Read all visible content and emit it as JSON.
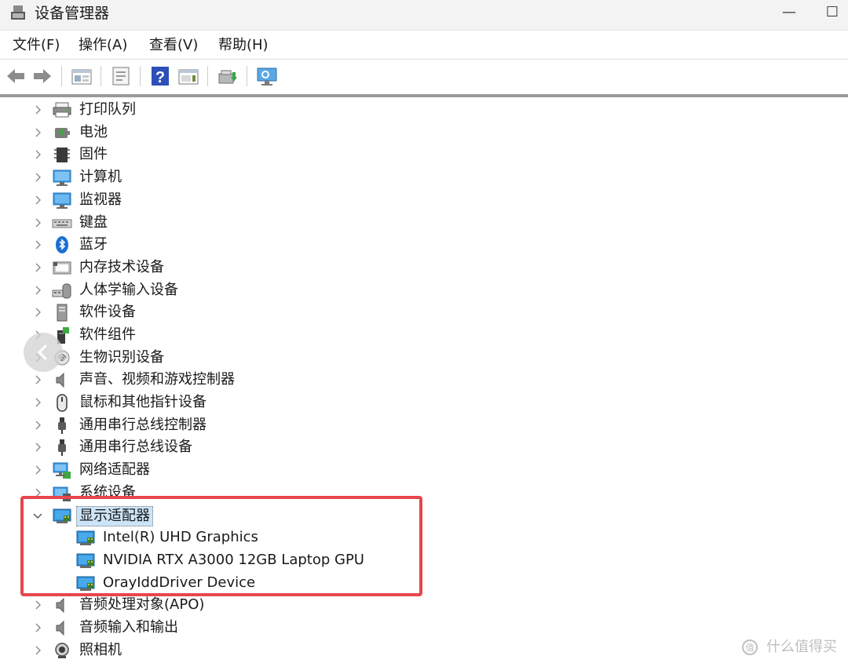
{
  "window": {
    "title": "设备管理器",
    "minimize_glyph": "—",
    "maximize_glyph": "☐"
  },
  "menu": {
    "items": [
      "文件(F)",
      "操作(A)",
      "查看(V)",
      "帮助(H)"
    ]
  },
  "toolbar": {
    "icons": [
      "back-arrow-icon",
      "forward-arrow-icon",
      "properties-grid-icon",
      "device-properties-icon",
      "help-icon",
      "action-pane-icon",
      "update-driver-icon",
      "scan-hardware-monitor-icon"
    ]
  },
  "tree": {
    "categories": [
      {
        "label": "打印队列",
        "icon": "print-queue-icon",
        "expanded": false
      },
      {
        "label": "电池",
        "icon": "battery-icon",
        "expanded": false
      },
      {
        "label": "固件",
        "icon": "firmware-icon",
        "expanded": false
      },
      {
        "label": "计算机",
        "icon": "computer-icon",
        "expanded": false
      },
      {
        "label": "监视器",
        "icon": "monitor-icon",
        "expanded": false
      },
      {
        "label": "键盘",
        "icon": "keyboard-icon",
        "expanded": false
      },
      {
        "label": "蓝牙",
        "icon": "bluetooth-icon",
        "expanded": false
      },
      {
        "label": "内存技术设备",
        "icon": "memory-device-icon",
        "expanded": false
      },
      {
        "label": "人体学输入设备",
        "icon": "hid-icon",
        "expanded": false
      },
      {
        "label": "软件设备",
        "icon": "software-device-icon",
        "expanded": false
      },
      {
        "label": "软件组件",
        "icon": "software-component-icon",
        "expanded": false
      },
      {
        "label": "生物识别设备",
        "icon": "fingerprint-icon",
        "expanded": false
      },
      {
        "label": "声音、视频和游戏控制器",
        "icon": "speaker-icon",
        "expanded": false
      },
      {
        "label": "鼠标和其他指针设备",
        "icon": "mouse-icon",
        "expanded": false
      },
      {
        "label": "通用串行总线控制器",
        "icon": "usb-icon",
        "expanded": false
      },
      {
        "label": "通用串行总线设备",
        "icon": "usb-icon",
        "expanded": false
      },
      {
        "label": "网络适配器",
        "icon": "network-adapter-icon",
        "expanded": false
      },
      {
        "label": "系统设备",
        "icon": "system-device-icon",
        "expanded": false
      },
      {
        "label": "显示适配器",
        "icon": "display-adapter-icon",
        "expanded": true,
        "selected": true,
        "children": [
          "Intel(R) UHD Graphics",
          "NVIDIA RTX A3000 12GB Laptop GPU",
          "OrayIddDriver Device"
        ]
      },
      {
        "label": "音频处理对象(APO)",
        "icon": "speaker-icon",
        "expanded": false
      },
      {
        "label": "音频输入和输出",
        "icon": "speaker-icon",
        "expanded": false
      },
      {
        "label": "照相机",
        "icon": "camera-icon",
        "expanded": false
      }
    ]
  },
  "colors": {
    "highlight_box": "#e8464e",
    "selection": "#cce4f7",
    "monitor_blue": "#2f8fd8"
  },
  "watermark": {
    "text": "什么值得买"
  }
}
